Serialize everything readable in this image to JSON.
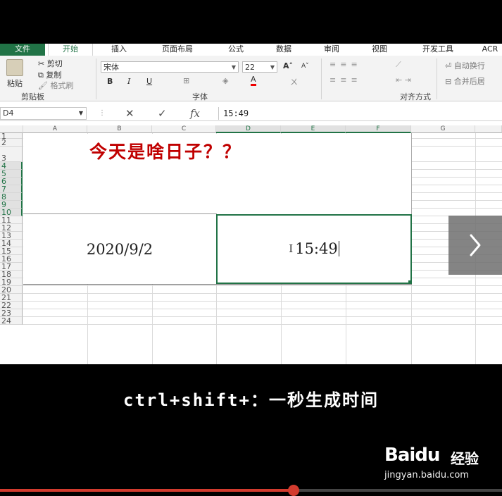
{
  "ribbon": {
    "tabs": [
      "文件",
      "开始",
      "插入",
      "页面布局",
      "公式",
      "数据",
      "审阅",
      "视图",
      "开发工具",
      "ACR"
    ],
    "active_tab": "开始",
    "clipboard": {
      "paste": "粘贴",
      "cut": "剪切",
      "copy": "复制",
      "format_painter": "格式刷",
      "group": "剪贴板"
    },
    "font": {
      "name": "宋体",
      "size": "22",
      "group": "字体",
      "bold": "B",
      "italic": "I",
      "underline": "U",
      "grow": "A",
      "shrink": "A",
      "font_color": "A"
    },
    "alignment": {
      "wrap": "自动换行",
      "merge": "合并后居",
      "group": "对齐方式"
    }
  },
  "formula_bar": {
    "cell_ref": "D4",
    "value": "15:49",
    "cancel_icon": "✕",
    "enter_icon": "✓",
    "fx": "fx"
  },
  "sheet": {
    "columns": [
      "A",
      "B",
      "C",
      "D",
      "E",
      "F",
      "G"
    ],
    "rows": [
      "1",
      "2",
      "3",
      "4",
      "5",
      "6",
      "7",
      "8",
      "9",
      "10",
      "11",
      "12",
      "13",
      "14",
      "15",
      "16",
      "17",
      "18",
      "19",
      "20",
      "21",
      "22",
      "23",
      "24"
    ],
    "title": "今天是啥日子？？",
    "date_value": "2020/9/2",
    "time_value": "15:49",
    "selected_cell": "D4"
  },
  "video": {
    "caption": "ctrl+shift+：一秒生成时间",
    "watermark_logo": "Baidu",
    "watermark_cn": "经验",
    "watermark_url": "jingyan.baidu.com",
    "progress": 0.585
  },
  "colors": {
    "accent": "#217346",
    "title_red": "#c00000",
    "progress_red": "#d23b2e"
  }
}
